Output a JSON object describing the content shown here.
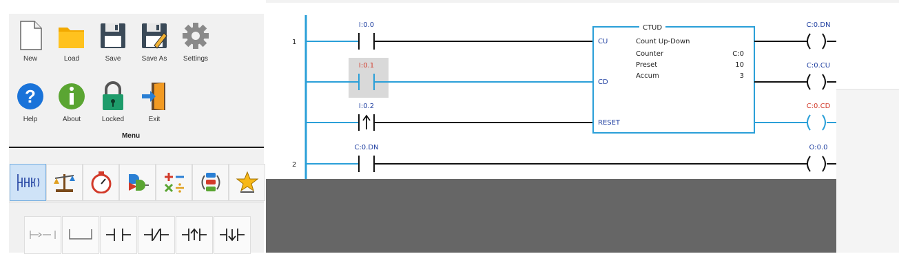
{
  "menu": {
    "title": "Menu",
    "buttons": [
      {
        "label": "New",
        "icon": "new-file-icon"
      },
      {
        "label": "Load",
        "icon": "folder-icon"
      },
      {
        "label": "Save",
        "icon": "floppy-icon"
      },
      {
        "label": "Save As",
        "icon": "floppy-pencil-icon"
      },
      {
        "label": "Settings",
        "icon": "gear-icon"
      },
      {
        "label": "Help",
        "icon": "help-icon"
      },
      {
        "label": "About",
        "icon": "info-icon"
      },
      {
        "label": "Locked",
        "icon": "lock-icon"
      },
      {
        "label": "Exit",
        "icon": "exit-door-icon"
      }
    ]
  },
  "toolbox": {
    "tabs": [
      {
        "icon": "bit-instructions-icon",
        "active": true
      },
      {
        "icon": "compare-scale-icon",
        "active": false
      },
      {
        "icon": "timer-stopwatch-icon",
        "active": false
      },
      {
        "icon": "logic-gates-icon",
        "active": false
      },
      {
        "icon": "math-operators-icon",
        "active": false
      },
      {
        "icon": "data-move-icon",
        "active": false
      },
      {
        "icon": "favorites-star-icon",
        "active": false
      }
    ],
    "instructions": [
      {
        "icon": "new-rung-icon"
      },
      {
        "icon": "new-branch-icon"
      },
      {
        "icon": "no-contact-icon"
      },
      {
        "icon": "nc-contact-icon"
      },
      {
        "icon": "positive-edge-contact-icon"
      },
      {
        "icon": "negative-edge-contact-icon"
      }
    ]
  },
  "ladder": {
    "rungs": [
      {
        "number": "1"
      },
      {
        "number": "2"
      }
    ],
    "contacts": {
      "c1": "I:0.0",
      "c2": "I:0.1",
      "c3": "I:0.2",
      "c4": "C:0.DN"
    },
    "coils": {
      "o1": "C:0.DN",
      "o2": "C:0.CU",
      "o3": "C:0.CD",
      "o4": "O:0.0"
    },
    "block": {
      "name": "CTUD",
      "description": "Count Up-Down",
      "counter_label": "Counter",
      "counter_value": "C:0",
      "preset_label": "Preset",
      "preset_value": "10",
      "accum_label": "Accum",
      "accum_value": "3",
      "pins": {
        "cu": "CU",
        "cd": "CD",
        "reset": "RESET"
      }
    }
  },
  "colors": {
    "energized": "#2a9fd8",
    "deenergized": "#111111",
    "tag_blue": "#1f3fa0",
    "tag_red": "#d23a2a",
    "selection": "#d9d9d9"
  }
}
